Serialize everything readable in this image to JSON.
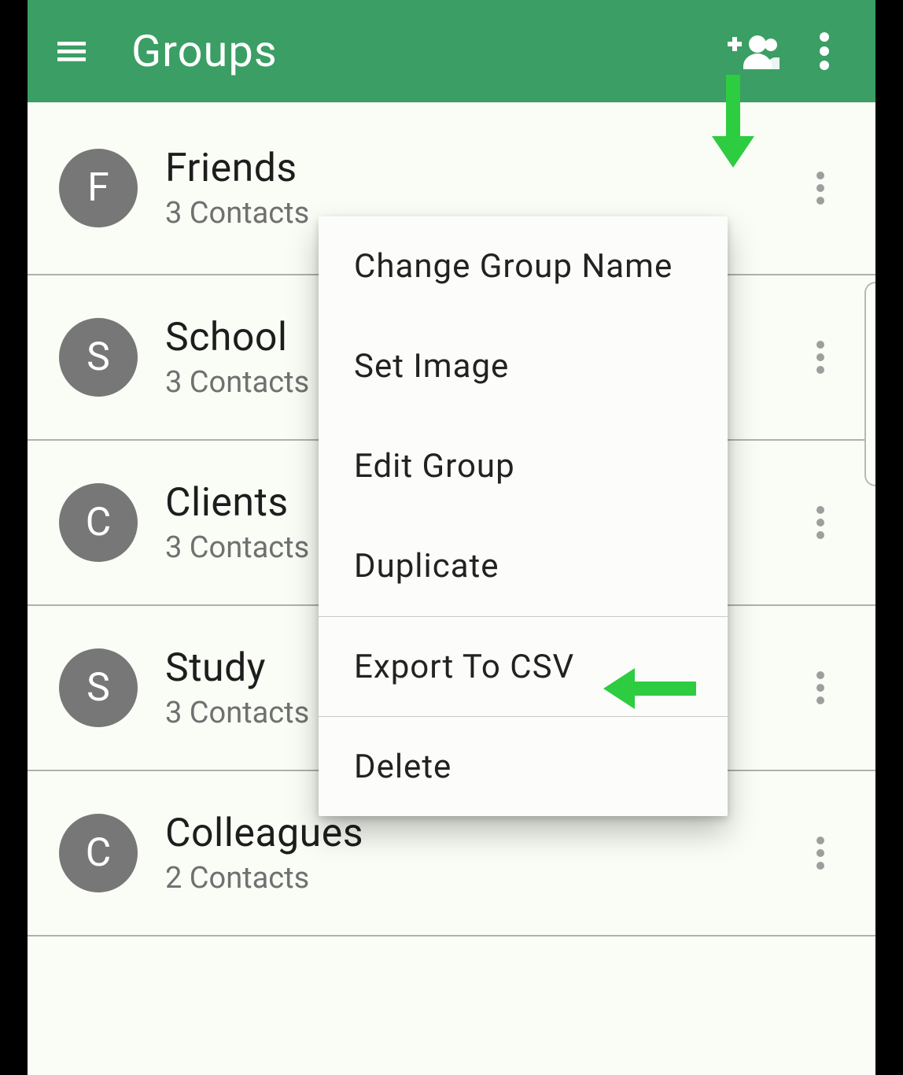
{
  "appbar": {
    "title": "Groups"
  },
  "groups": [
    {
      "letter": "F",
      "name": "Friends",
      "sub": "3 Contacts"
    },
    {
      "letter": "S",
      "name": "School",
      "sub": "3 Contacts"
    },
    {
      "letter": "C",
      "name": "Clients",
      "sub": "3 Contacts"
    },
    {
      "letter": "S",
      "name": "Study",
      "sub": "3 Contacts"
    },
    {
      "letter": "C",
      "name": "Colleagues",
      "sub": "2 Contacts"
    }
  ],
  "menu": {
    "items": [
      "Change Group Name",
      "Set Image",
      "Edit Group",
      "Duplicate",
      "Export To CSV",
      "Delete"
    ]
  },
  "colors": {
    "accent": "#3b9e64",
    "arrow": "#2ecc40"
  }
}
